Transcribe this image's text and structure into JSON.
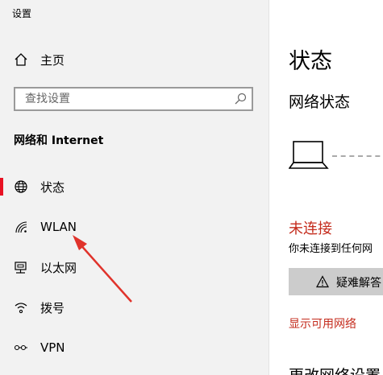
{
  "window": {
    "title": "设置"
  },
  "sidebar": {
    "home_label": "主页",
    "search_placeholder": "查找设置",
    "section_title": "网络和 Internet",
    "items": [
      {
        "label": "状态",
        "icon": "globe-icon",
        "active": true
      },
      {
        "label": "WLAN",
        "icon": "wifi-icon",
        "active": false
      },
      {
        "label": "以太网",
        "icon": "ethernet-icon",
        "active": false
      },
      {
        "label": "拨号",
        "icon": "dialup-icon",
        "active": false
      },
      {
        "label": "VPN",
        "icon": "vpn-icon",
        "active": false
      }
    ]
  },
  "main": {
    "title": "状态",
    "network_status_title": "网络状态",
    "status_text": "未连接",
    "status_description": "你未连接到任何网",
    "troubleshoot_label": "疑难解答",
    "show_networks_link": "显示可用网络",
    "change_settings_title": "更改网络设置"
  },
  "colors": {
    "accent": "#e81123",
    "status_red": "#c42b1c",
    "annotation_arrow": "#e0332b"
  }
}
